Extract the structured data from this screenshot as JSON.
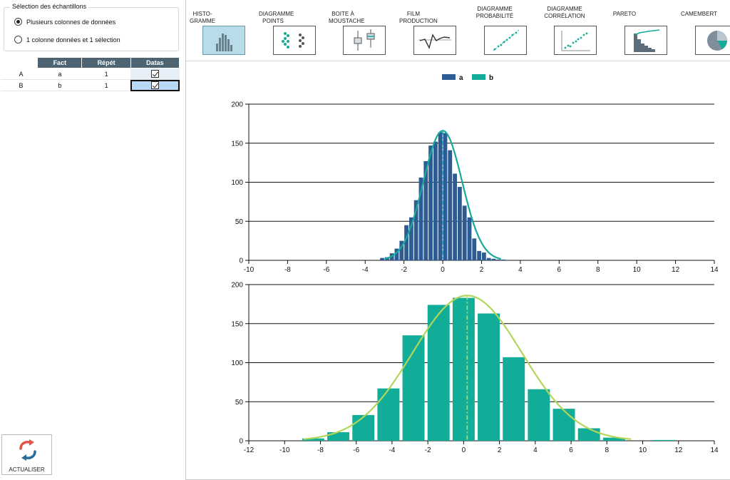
{
  "sample_selection": {
    "title": "Sélection des échantillons",
    "options": [
      {
        "label": "Plusieurs colonnes de données",
        "selected": true
      },
      {
        "label": "1 colonne données et 1 sélection",
        "selected": false
      }
    ]
  },
  "samples_table": {
    "headers": [
      "Fact",
      "Répét",
      "Datas"
    ],
    "rows": [
      {
        "id": "A",
        "fact": "a",
        "repet": "1",
        "datas_checked": true,
        "selected": false
      },
      {
        "id": "B",
        "fact": "b",
        "repet": "1",
        "datas_checked": true,
        "selected": true
      }
    ]
  },
  "refresh_button": {
    "label": "ACTUALISER",
    "icon": "refresh-icon"
  },
  "toolbar": {
    "items": [
      {
        "key": "histogram",
        "label": "HISTO- GRAMME",
        "icon": "histogram-icon",
        "active": true
      },
      {
        "key": "dot-plot",
        "label": "DIAGRAMME POINTS",
        "icon": "dot-plot-icon",
        "active": false
      },
      {
        "key": "box-plot",
        "label": "BOITE À MOUSTACHE",
        "icon": "box-plot-icon",
        "active": false
      },
      {
        "key": "run-chart",
        "label": "FILM PRODUCTION",
        "icon": "run-chart-icon",
        "active": false
      },
      {
        "key": "probability-plot",
        "label": "DIAGRAMME PROBABILITÉ",
        "icon": "probability-plot-icon",
        "active": false
      },
      {
        "key": "correlation-plot",
        "label": "DIAGRAMME CORRÉLATION",
        "icon": "scatter-plot-icon",
        "active": false
      },
      {
        "key": "pareto",
        "label": "PARETO",
        "icon": "pareto-icon",
        "active": false
      },
      {
        "key": "pie",
        "label": "CAMEMBERT",
        "icon": "pie-chart-icon",
        "active": false
      }
    ]
  },
  "colors": {
    "series_a": "#2d5c94",
    "series_b": "#12ad98",
    "fit_a": "#17a99a",
    "fit_b": "#b2d65a",
    "mean_a": "#1fb2b8",
    "mean_b": "#c2dc5e",
    "grid": "#111111"
  },
  "chart_data": [
    {
      "type": "bar",
      "title": "",
      "legend": {
        "placement": "top-center",
        "entries": [
          "a",
          "b"
        ]
      },
      "xlim": [
        -10,
        14
      ],
      "ylim": [
        0,
        200
      ],
      "xticks": [
        -10,
        -8,
        -6,
        -4,
        -2,
        0,
        2,
        4,
        6,
        8,
        10,
        12,
        14
      ],
      "yticks": [
        0,
        50,
        100,
        150,
        200
      ],
      "grid": "horizontal",
      "series": [
        {
          "name": "a",
          "bin_width": 0.25,
          "x": [
            -3.125,
            -2.875,
            -2.625,
            -2.375,
            -2.125,
            -1.875,
            -1.625,
            -1.375,
            -1.125,
            -0.875,
            -0.625,
            -0.375,
            -0.125,
            0.125,
            0.375,
            0.625,
            0.875,
            1.125,
            1.375,
            1.625,
            1.875,
            2.125,
            2.375,
            2.625,
            2.875,
            3.125
          ],
          "values": [
            3,
            4,
            9,
            15,
            25,
            45,
            55,
            77,
            106,
            127,
            147,
            152,
            164,
            163,
            141,
            111,
            94,
            70,
            55,
            28,
            12,
            10,
            3,
            2,
            1,
            1
          ]
        }
      ],
      "fit_curve": {
        "type": "normal",
        "mean": 0,
        "sd": 1,
        "peak": 166
      },
      "mean_line": 0
    },
    {
      "type": "bar",
      "title": "",
      "xlim": [
        -12,
        14
      ],
      "ylim": [
        0,
        200
      ],
      "xticks": [
        -12,
        -10,
        -8,
        -6,
        -4,
        -2,
        0,
        2,
        4,
        6,
        8,
        10,
        12,
        14
      ],
      "yticks": [
        0,
        50,
        100,
        150,
        200
      ],
      "grid": "horizontal",
      "series": [
        {
          "name": "b",
          "bin_width": 1.4,
          "x": [
            -8.4,
            -7,
            -5.6,
            -4.2,
            -2.8,
            -1.4,
            0,
            1.4,
            2.8,
            4.2,
            5.6,
            7,
            8.4,
            9.8,
            11.2
          ],
          "values": [
            3,
            11,
            33,
            67,
            135,
            174,
            183,
            163,
            107,
            66,
            41,
            16,
            4,
            0,
            1
          ]
        }
      ],
      "fit_curve": {
        "type": "normal",
        "mean": 0.2,
        "sd": 3.05,
        "peak": 186
      },
      "mean_line": 0.2
    }
  ]
}
